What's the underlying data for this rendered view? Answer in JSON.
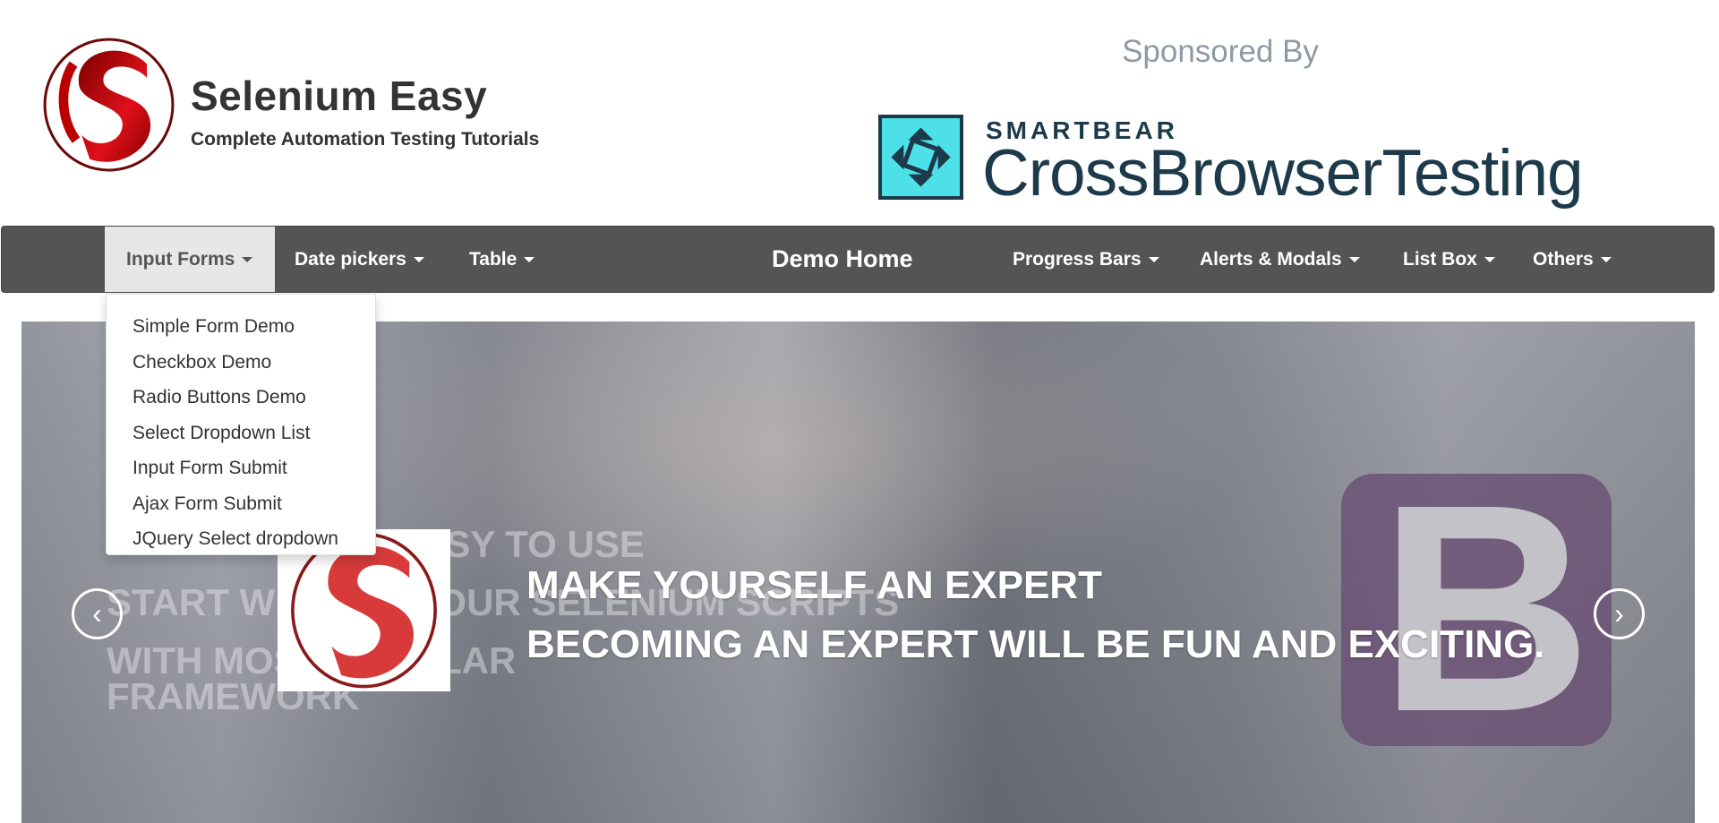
{
  "header": {
    "brand_title": "Selenium Easy",
    "brand_subtitle": "Complete Automation Testing Tutorials",
    "sponsored_label": "Sponsored By",
    "sponsor_company": "SMARTBEAR",
    "sponsor_product": "CrossBrowserTesting"
  },
  "nav": {
    "items": [
      {
        "label": "Input Forms"
      },
      {
        "label": "Date pickers"
      },
      {
        "label": "Table"
      },
      {
        "label": "Demo Home"
      },
      {
        "label": "Progress Bars"
      },
      {
        "label": "Alerts & Modals"
      },
      {
        "label": "List Box"
      },
      {
        "label": "Others"
      }
    ],
    "active": "Input Forms"
  },
  "dropdown": {
    "items": [
      "Simple Form Demo",
      "Checkbox Demo",
      "Radio Buttons Demo",
      "Select Dropdown List",
      "Input Form Submit",
      "Ajax Form Submit",
      "JQuery Select dropdown"
    ]
  },
  "carousel": {
    "faded_lines": [
      "EASY TO USE",
      "START WRITING YOUR SELENIUM SCRIPTS",
      "WITH MOST POPULAR",
      "FRAMEWORK"
    ],
    "caption_line1": "MAKE YOURSELF AN EXPERT",
    "caption_line2": "BECOMING AN EXPERT WILL BE FUN AND EXCITING.",
    "bootstrap_letter": "B",
    "prev_icon": "‹",
    "next_icon": "›"
  },
  "colors": {
    "navbar": "#545454",
    "active_nav": "#e7e7e7",
    "brand_red": "#c8101a",
    "sponsor_teal": "#4ee0e8",
    "sponsor_dark": "#1d3a4a"
  }
}
